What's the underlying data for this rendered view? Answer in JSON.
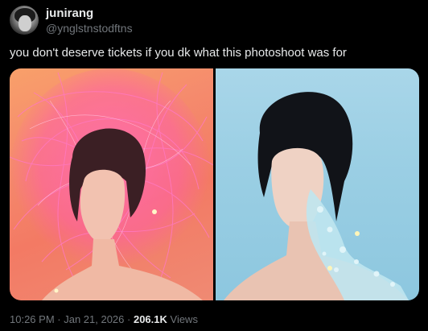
{
  "user": {
    "display_name": "junirang",
    "handle": "@ynglstnstodftns"
  },
  "tweet": {
    "text": "you don't deserve tickets if you dk what this photoshoot was for"
  },
  "meta": {
    "time": "10:26 PM",
    "separator1": " · ",
    "date": "Jan 21, 2026",
    "separator2": " · ",
    "views_count": "206.1K",
    "views_label": " Views"
  },
  "colors": {
    "background": "#000000",
    "primary_text": "#e7e9ea",
    "secondary_text": "#71767b"
  }
}
